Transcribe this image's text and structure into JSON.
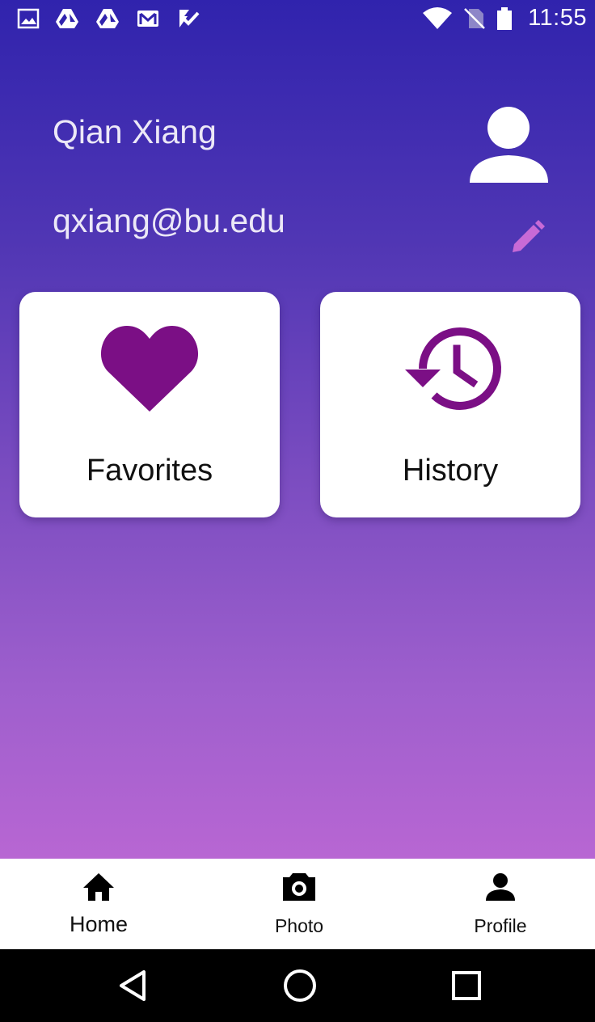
{
  "status_bar": {
    "time": "11:55",
    "left_icons": [
      "image-icon",
      "drive-icon",
      "drive-icon",
      "gmail-icon",
      "checklist-icon"
    ],
    "right_icons": [
      "wifi-icon",
      "no-sim-icon",
      "battery-icon"
    ]
  },
  "profile": {
    "name": "Qian Xiang",
    "email": "qxiang@bu.edu"
  },
  "cards": [
    {
      "label": "Favorites",
      "icon": "heart-icon"
    },
    {
      "label": "History",
      "icon": "history-icon"
    }
  ],
  "bottom_nav": {
    "home": "Home",
    "photo": "Photo",
    "profile": "Profile"
  },
  "colors": {
    "accent": "#7b0f85",
    "edit_icon": "#c86ad6",
    "gradient_top": "#3023ad",
    "gradient_bottom": "#b866d3"
  }
}
